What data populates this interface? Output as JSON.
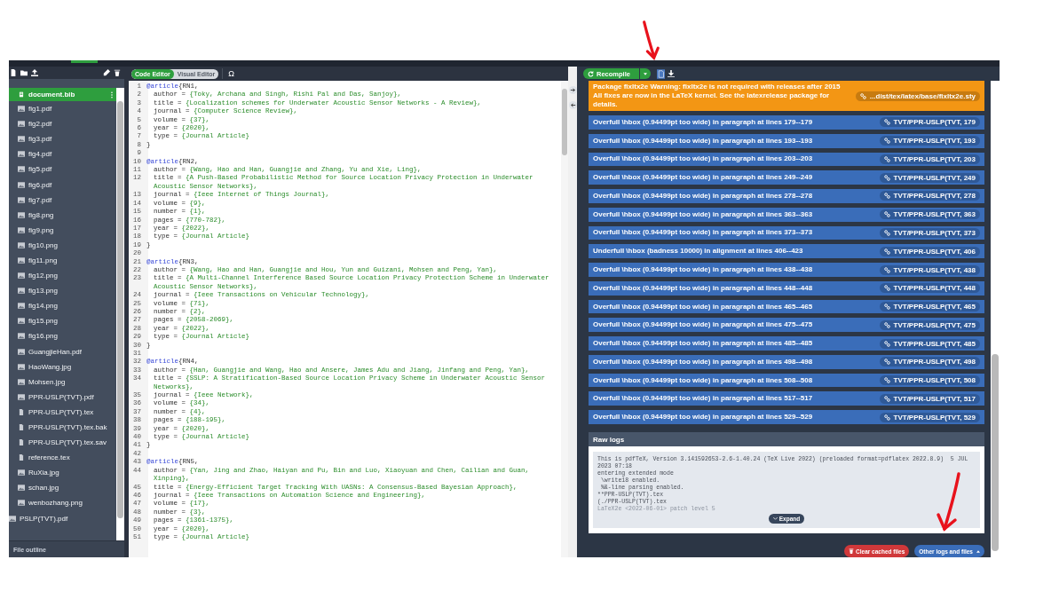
{
  "file_tree": [
    {
      "children": [
        {
          "name": "document.bib",
          "kind": "bib",
          "selected": true
        },
        {
          "name": "fig1.pdf",
          "kind": "image",
          "selected": false
        },
        {
          "name": "fig2.pdf",
          "kind": "image",
          "selected": false
        },
        {
          "name": "fig3.pdf",
          "kind": "image",
          "selected": false
        },
        {
          "name": "fig4.pdf",
          "kind": "image",
          "selected": false
        },
        {
          "name": "fig5.pdf",
          "kind": "image",
          "selected": false
        },
        {
          "name": "fig6.pdf",
          "kind": "image",
          "selected": false
        },
        {
          "name": "fig7.pdf",
          "kind": "image",
          "selected": false
        },
        {
          "name": "fig8.png",
          "kind": "image",
          "selected": false
        },
        {
          "name": "fig9.png",
          "kind": "image",
          "selected": false
        },
        {
          "name": "fig10.png",
          "kind": "image",
          "selected": false
        },
        {
          "name": "fig11.png",
          "kind": "image",
          "selected": false
        },
        {
          "name": "fig12.png",
          "kind": "image",
          "selected": false
        },
        {
          "name": "fig13.png",
          "kind": "image",
          "selected": false
        },
        {
          "name": "fig14.png",
          "kind": "image",
          "selected": false
        },
        {
          "name": "fig15.png",
          "kind": "image",
          "selected": false
        },
        {
          "name": "fig16.png",
          "kind": "image",
          "selected": false
        },
        {
          "name": "GuangjieHan.pdf",
          "kind": "image",
          "selected": false
        },
        {
          "name": "HaoWang.jpg",
          "kind": "image",
          "selected": false
        },
        {
          "name": "Mohsen.jpg",
          "kind": "image",
          "selected": false
        },
        {
          "name": "PPR-USLP(TVT).pdf",
          "kind": "image",
          "selected": false
        },
        {
          "name": "PPR-USLP(TVT).tex",
          "kind": "file",
          "selected": false
        },
        {
          "name": "PPR-USLP(TVT).tex.bak",
          "kind": "file",
          "selected": false
        },
        {
          "name": "PPR-USLP(TVT).tex.sav",
          "kind": "file",
          "selected": false
        },
        {
          "name": "reference.tex",
          "kind": "file",
          "selected": false
        },
        {
          "name": "RuXia.jpg",
          "kind": "image",
          "selected": false
        },
        {
          "name": "schan.jpg",
          "kind": "image",
          "selected": false
        },
        {
          "name": "wenbozhang.png",
          "kind": "image",
          "selected": false
        }
      ]
    },
    {
      "name": "PSLP(TVT).pdf",
      "kind": "image",
      "selected": false
    }
  ],
  "file_outline": "File outline",
  "editor_modes": [
    {
      "label": "Code Editor",
      "selected": true
    },
    {
      "label": "Visual Editor",
      "selected": false
    }
  ],
  "symbol_button": "Ω",
  "code_lines": [
    {
      "n": "1",
      "kind": "entry",
      "keyword": "@article",
      "text": "{RN1,"
    },
    {
      "n": "2",
      "kind": "field",
      "key": "author =",
      "value": "{Toky, Archana and Singh, Rishi Pal and Das, Sanjoy},"
    },
    {
      "n": "3",
      "kind": "field",
      "key": "title =",
      "value": "{Localization schemes for Underwater Acoustic Sensor Networks - A Review},"
    },
    {
      "n": "4",
      "kind": "field",
      "key": "journal =",
      "value": "{Computer Science Review},"
    },
    {
      "n": "5",
      "kind": "field",
      "key": "volume =",
      "value": "{37},"
    },
    {
      "n": "6",
      "kind": "field",
      "key": "year =",
      "value": "{2020},"
    },
    {
      "n": "7",
      "kind": "field",
      "key": "type =",
      "value": "{Journal Article}"
    },
    {
      "n": "8",
      "kind": "text",
      "text": "}"
    },
    {
      "n": "9",
      "kind": "blank"
    },
    {
      "n": "10",
      "kind": "entry",
      "keyword": "@article",
      "text": "{RN2,"
    },
    {
      "n": "11",
      "kind": "field",
      "key": "author =",
      "value": "{Wang, Hao and Han, Guangjie and Zhang, Yu and Xie, Ling},"
    },
    {
      "n": "12",
      "kind": "field",
      "key": "title =",
      "value": "{A Push-Based Probabilistic Method for Source Location Privacy Protection in Underwater Acoustic Sensor Networks},"
    },
    {
      "n": "13",
      "kind": "field",
      "key": "journal =",
      "value": "{Ieee Internet of Things Journal},"
    },
    {
      "n": "14",
      "kind": "field",
      "key": "volume =",
      "value": "{9},"
    },
    {
      "n": "15",
      "kind": "field",
      "key": "number =",
      "value": "{1},"
    },
    {
      "n": "16",
      "kind": "field",
      "key": "pages =",
      "value": "{770-782},"
    },
    {
      "n": "17",
      "kind": "field",
      "key": "year =",
      "value": "{2022},"
    },
    {
      "n": "18",
      "kind": "field",
      "key": "type =",
      "value": "{Journal Article}"
    },
    {
      "n": "19",
      "kind": "text",
      "text": "}"
    },
    {
      "n": "20",
      "kind": "blank"
    },
    {
      "n": "21",
      "kind": "entry",
      "keyword": "@article",
      "text": "{RN3,"
    },
    {
      "n": "22",
      "kind": "field",
      "key": "author =",
      "value": "{Wang, Hao and Han, Guangjie and Hou, Yun and Guizani, Mohsen and Peng, Yan},"
    },
    {
      "n": "23",
      "kind": "field",
      "key": "title =",
      "value": "{A Multi-Channel Interference Based Source Location Privacy Protection Scheme in Underwater Acoustic Sensor Networks},"
    },
    {
      "n": "24",
      "kind": "field",
      "key": "journal =",
      "value": "{Ieee Transactions on Vehicular Technology},"
    },
    {
      "n": "25",
      "kind": "field",
      "key": "volume =",
      "value": "{71},"
    },
    {
      "n": "26",
      "kind": "field",
      "key": "number =",
      "value": "{2},"
    },
    {
      "n": "27",
      "kind": "field",
      "key": "pages =",
      "value": "{2058-2069},"
    },
    {
      "n": "28",
      "kind": "field",
      "key": "year =",
      "value": "{2022},"
    },
    {
      "n": "29",
      "kind": "field",
      "key": "type =",
      "value": "{Journal Article}"
    },
    {
      "n": "30",
      "kind": "text",
      "text": "}"
    },
    {
      "n": "31",
      "kind": "blank"
    },
    {
      "n": "32",
      "kind": "entry",
      "keyword": "@article",
      "text": "{RN4,"
    },
    {
      "n": "33",
      "kind": "field",
      "key": "author =",
      "value": "{Han, Guangjie and Wang, Hao and Ansere, James Adu and Jiang, Jinfang and Peng, Yan},"
    },
    {
      "n": "34",
      "kind": "field",
      "key": "title =",
      "value": "{SSLP: A Stratification-Based Source Location Privacy Scheme in Underwater Acoustic Sensor Networks},"
    },
    {
      "n": "35",
      "kind": "field",
      "key": "journal =",
      "value": "{Ieee Network},"
    },
    {
      "n": "36",
      "kind": "field",
      "key": "volume =",
      "value": "{34},"
    },
    {
      "n": "37",
      "kind": "field",
      "key": "number =",
      "value": "{4},"
    },
    {
      "n": "38",
      "kind": "field",
      "key": "pages =",
      "value": "{188-195},"
    },
    {
      "n": "39",
      "kind": "field",
      "key": "year =",
      "value": "{2020},"
    },
    {
      "n": "40",
      "kind": "field",
      "key": "type =",
      "value": "{Journal Article}"
    },
    {
      "n": "41",
      "kind": "text",
      "text": "}"
    },
    {
      "n": "42",
      "kind": "blank"
    },
    {
      "n": "43",
      "kind": "entry",
      "keyword": "@article",
      "text": "{RN5,"
    },
    {
      "n": "44",
      "kind": "field",
      "key": "author =",
      "value": "{Yan, Jing and Zhao, Haiyan and Pu, Bin and Luo, Xiaoyuan and Chen, Cailian and Guan, Xinping},"
    },
    {
      "n": "45",
      "kind": "field",
      "key": "title =",
      "value": "{Energy-Efficient Target Tracking With UASNs: A Consensus-Based Bayesian Approach},"
    },
    {
      "n": "46",
      "kind": "field",
      "key": "journal =",
      "value": "{Ieee Transactions on Automation Science and Engineering},"
    },
    {
      "n": "47",
      "kind": "field",
      "key": "volume =",
      "value": "{17},"
    },
    {
      "n": "48",
      "kind": "field",
      "key": "number =",
      "value": "{3},"
    },
    {
      "n": "49",
      "kind": "field",
      "key": "pages =",
      "value": "{1361-1375},"
    },
    {
      "n": "50",
      "kind": "field",
      "key": "year =",
      "value": "{2020},"
    },
    {
      "n": "51",
      "kind": "field",
      "key": "type =",
      "value": "{Journal Article}"
    }
  ],
  "recompile_button": "Recompile",
  "log_entries": [
    {
      "kind": "warning",
      "text": "Package fixltx2e Warning: fixltx2e is not required with releases after 2015 All fixes are now in the LaTeX kernel. See the latexrelease package for details.",
      "file": "...dist/tex/latex/base/fixltx2e.sty"
    },
    {
      "kind": "info",
      "text": "Overfull \\hbox (0.94499pt too wide) in paragraph at lines 179--179",
      "file": "TVT/PPR-USLP(TVT, 179"
    },
    {
      "kind": "info",
      "text": "Overfull \\hbox (0.94499pt too wide) in paragraph at lines 193--193",
      "file": "TVT/PPR-USLP(TVT, 193"
    },
    {
      "kind": "info",
      "text": "Overfull \\hbox (0.94499pt too wide) in paragraph at lines 203--203",
      "file": "TVT/PPR-USLP(TVT, 203"
    },
    {
      "kind": "info",
      "text": "Overfull \\hbox (0.94499pt too wide) in paragraph at lines 249--249",
      "file": "TVT/PPR-USLP(TVT, 249"
    },
    {
      "kind": "info",
      "text": "Overfull \\hbox (0.94499pt too wide) in paragraph at lines 278--278",
      "file": "TVT/PPR-USLP(TVT, 278"
    },
    {
      "kind": "info",
      "text": "Overfull \\hbox (0.94499pt too wide) in paragraph at lines 363--363",
      "file": "TVT/PPR-USLP(TVT, 363"
    },
    {
      "kind": "info",
      "text": "Overfull \\hbox (0.94499pt too wide) in paragraph at lines 373--373",
      "file": "TVT/PPR-USLP(TVT, 373"
    },
    {
      "kind": "info",
      "text": "Underfull \\hbox (badness 10000) in alignment at lines 406--423",
      "file": "TVT/PPR-USLP(TVT, 406"
    },
    {
      "kind": "info",
      "text": "Overfull \\hbox (0.94499pt too wide) in paragraph at lines 438--438",
      "file": "TVT/PPR-USLP(TVT, 438"
    },
    {
      "kind": "info",
      "text": "Overfull \\hbox (0.94499pt too wide) in paragraph at lines 448--448",
      "file": "TVT/PPR-USLP(TVT, 448"
    },
    {
      "kind": "info",
      "text": "Overfull \\hbox (0.94499pt too wide) in paragraph at lines 465--465",
      "file": "TVT/PPR-USLP(TVT, 465"
    },
    {
      "kind": "info",
      "text": "Overfull \\hbox (0.94499pt too wide) in paragraph at lines 475--475",
      "file": "TVT/PPR-USLP(TVT, 475"
    },
    {
      "kind": "info",
      "text": "Overfull \\hbox (0.94499pt too wide) in paragraph at lines 485--485",
      "file": "TVT/PPR-USLP(TVT, 485"
    },
    {
      "kind": "info",
      "text": "Overfull \\hbox (0.94499pt too wide) in paragraph at lines 498--498",
      "file": "TVT/PPR-USLP(TVT, 498"
    },
    {
      "kind": "info",
      "text": "Overfull \\hbox (0.94499pt too wide) in paragraph at lines 508--508",
      "file": "TVT/PPR-USLP(TVT, 508"
    },
    {
      "kind": "info",
      "text": "Overfull \\hbox (0.94499pt too wide) in paragraph at lines 517--517",
      "file": "TVT/PPR-USLP(TVT, 517"
    },
    {
      "kind": "info",
      "text": "Overfull \\hbox (0.94499pt too wide) in paragraph at lines 529--529",
      "file": "TVT/PPR-USLP(TVT, 529"
    }
  ],
  "raw_logs": {
    "title": "Raw logs",
    "lines": [
      "This is pdfTeX, Version 3.141592653-2.6-1.40.24 (TeX Live 2022) (preloaded format=pdflatex 2022.8.9)  5 JUL 2023 07:18",
      "entering extended mode",
      " \\write18 enabled.",
      " %&-line parsing enabled.",
      "**PPR-USLP(TVT).tex",
      "(./PPR-USLP(TVT).tex",
      "LaTeX2e <2022-06-01> patch level 5"
    ],
    "expand_button": "Expand"
  },
  "footer_buttons": [
    {
      "kind": "danger",
      "label": "Clear cached files"
    },
    {
      "kind": "primary",
      "label": "Other logs and files"
    }
  ]
}
